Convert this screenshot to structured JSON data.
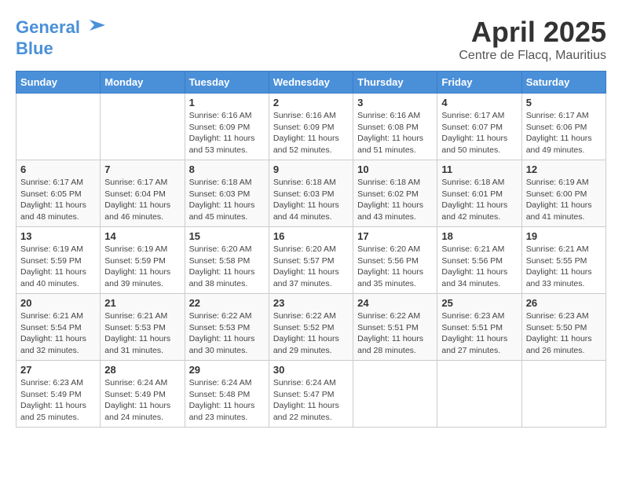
{
  "header": {
    "logo_line1": "General",
    "logo_line2": "Blue",
    "month_title": "April 2025",
    "location": "Centre de Flacq, Mauritius"
  },
  "weekdays": [
    "Sunday",
    "Monday",
    "Tuesday",
    "Wednesday",
    "Thursday",
    "Friday",
    "Saturday"
  ],
  "weeks": [
    [
      null,
      null,
      {
        "day": "1",
        "sunrise": "Sunrise: 6:16 AM",
        "sunset": "Sunset: 6:09 PM",
        "daylight": "Daylight: 11 hours and 53 minutes."
      },
      {
        "day": "2",
        "sunrise": "Sunrise: 6:16 AM",
        "sunset": "Sunset: 6:09 PM",
        "daylight": "Daylight: 11 hours and 52 minutes."
      },
      {
        "day": "3",
        "sunrise": "Sunrise: 6:16 AM",
        "sunset": "Sunset: 6:08 PM",
        "daylight": "Daylight: 11 hours and 51 minutes."
      },
      {
        "day": "4",
        "sunrise": "Sunrise: 6:17 AM",
        "sunset": "Sunset: 6:07 PM",
        "daylight": "Daylight: 11 hours and 50 minutes."
      },
      {
        "day": "5",
        "sunrise": "Sunrise: 6:17 AM",
        "sunset": "Sunset: 6:06 PM",
        "daylight": "Daylight: 11 hours and 49 minutes."
      }
    ],
    [
      {
        "day": "6",
        "sunrise": "Sunrise: 6:17 AM",
        "sunset": "Sunset: 6:05 PM",
        "daylight": "Daylight: 11 hours and 48 minutes."
      },
      {
        "day": "7",
        "sunrise": "Sunrise: 6:17 AM",
        "sunset": "Sunset: 6:04 PM",
        "daylight": "Daylight: 11 hours and 46 minutes."
      },
      {
        "day": "8",
        "sunrise": "Sunrise: 6:18 AM",
        "sunset": "Sunset: 6:03 PM",
        "daylight": "Daylight: 11 hours and 45 minutes."
      },
      {
        "day": "9",
        "sunrise": "Sunrise: 6:18 AM",
        "sunset": "Sunset: 6:03 PM",
        "daylight": "Daylight: 11 hours and 44 minutes."
      },
      {
        "day": "10",
        "sunrise": "Sunrise: 6:18 AM",
        "sunset": "Sunset: 6:02 PM",
        "daylight": "Daylight: 11 hours and 43 minutes."
      },
      {
        "day": "11",
        "sunrise": "Sunrise: 6:18 AM",
        "sunset": "Sunset: 6:01 PM",
        "daylight": "Daylight: 11 hours and 42 minutes."
      },
      {
        "day": "12",
        "sunrise": "Sunrise: 6:19 AM",
        "sunset": "Sunset: 6:00 PM",
        "daylight": "Daylight: 11 hours and 41 minutes."
      }
    ],
    [
      {
        "day": "13",
        "sunrise": "Sunrise: 6:19 AM",
        "sunset": "Sunset: 5:59 PM",
        "daylight": "Daylight: 11 hours and 40 minutes."
      },
      {
        "day": "14",
        "sunrise": "Sunrise: 6:19 AM",
        "sunset": "Sunset: 5:59 PM",
        "daylight": "Daylight: 11 hours and 39 minutes."
      },
      {
        "day": "15",
        "sunrise": "Sunrise: 6:20 AM",
        "sunset": "Sunset: 5:58 PM",
        "daylight": "Daylight: 11 hours and 38 minutes."
      },
      {
        "day": "16",
        "sunrise": "Sunrise: 6:20 AM",
        "sunset": "Sunset: 5:57 PM",
        "daylight": "Daylight: 11 hours and 37 minutes."
      },
      {
        "day": "17",
        "sunrise": "Sunrise: 6:20 AM",
        "sunset": "Sunset: 5:56 PM",
        "daylight": "Daylight: 11 hours and 35 minutes."
      },
      {
        "day": "18",
        "sunrise": "Sunrise: 6:21 AM",
        "sunset": "Sunset: 5:56 PM",
        "daylight": "Daylight: 11 hours and 34 minutes."
      },
      {
        "day": "19",
        "sunrise": "Sunrise: 6:21 AM",
        "sunset": "Sunset: 5:55 PM",
        "daylight": "Daylight: 11 hours and 33 minutes."
      }
    ],
    [
      {
        "day": "20",
        "sunrise": "Sunrise: 6:21 AM",
        "sunset": "Sunset: 5:54 PM",
        "daylight": "Daylight: 11 hours and 32 minutes."
      },
      {
        "day": "21",
        "sunrise": "Sunrise: 6:21 AM",
        "sunset": "Sunset: 5:53 PM",
        "daylight": "Daylight: 11 hours and 31 minutes."
      },
      {
        "day": "22",
        "sunrise": "Sunrise: 6:22 AM",
        "sunset": "Sunset: 5:53 PM",
        "daylight": "Daylight: 11 hours and 30 minutes."
      },
      {
        "day": "23",
        "sunrise": "Sunrise: 6:22 AM",
        "sunset": "Sunset: 5:52 PM",
        "daylight": "Daylight: 11 hours and 29 minutes."
      },
      {
        "day": "24",
        "sunrise": "Sunrise: 6:22 AM",
        "sunset": "Sunset: 5:51 PM",
        "daylight": "Daylight: 11 hours and 28 minutes."
      },
      {
        "day": "25",
        "sunrise": "Sunrise: 6:23 AM",
        "sunset": "Sunset: 5:51 PM",
        "daylight": "Daylight: 11 hours and 27 minutes."
      },
      {
        "day": "26",
        "sunrise": "Sunrise: 6:23 AM",
        "sunset": "Sunset: 5:50 PM",
        "daylight": "Daylight: 11 hours and 26 minutes."
      }
    ],
    [
      {
        "day": "27",
        "sunrise": "Sunrise: 6:23 AM",
        "sunset": "Sunset: 5:49 PM",
        "daylight": "Daylight: 11 hours and 25 minutes."
      },
      {
        "day": "28",
        "sunrise": "Sunrise: 6:24 AM",
        "sunset": "Sunset: 5:49 PM",
        "daylight": "Daylight: 11 hours and 24 minutes."
      },
      {
        "day": "29",
        "sunrise": "Sunrise: 6:24 AM",
        "sunset": "Sunset: 5:48 PM",
        "daylight": "Daylight: 11 hours and 23 minutes."
      },
      {
        "day": "30",
        "sunrise": "Sunrise: 6:24 AM",
        "sunset": "Sunset: 5:47 PM",
        "daylight": "Daylight: 11 hours and 22 minutes."
      },
      null,
      null,
      null
    ]
  ]
}
